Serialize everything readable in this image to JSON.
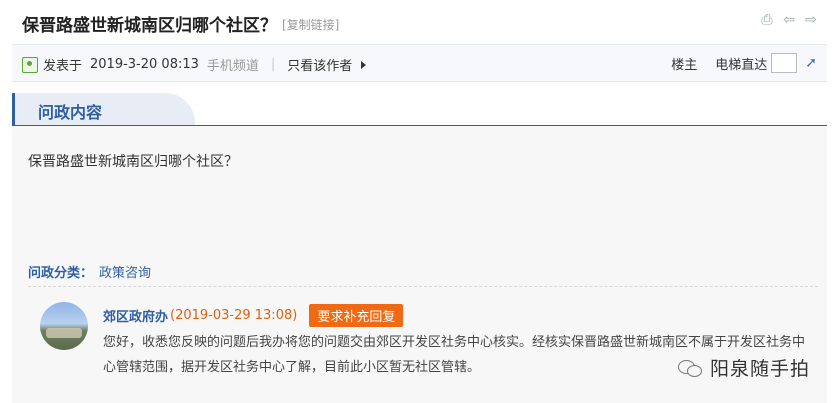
{
  "post": {
    "title": "保晋路盛世新城南区归哪个社区？",
    "copy_link": "[复制链接]"
  },
  "meta": {
    "posted_prefix": "发表于",
    "posted_date": "2019-3-20 08:13",
    "channel": "手机频道",
    "separator": "|",
    "only_author": "只看该作者",
    "floor_host": "楼主",
    "elevator_label": "电梯直达",
    "elevator_value": ""
  },
  "section": {
    "tab_label": "问政内容"
  },
  "content": {
    "question": "保晋路盛世新城南区归哪个社区？",
    "category_label": "问政分类：",
    "category_value": "政策咨询"
  },
  "reply": {
    "author": "郊区政府办",
    "time": "(2019-03-29 13:08)",
    "supplement_button": "要求补充回复",
    "body": "您好，收悉您反映的问题后我办将您的问题交由郊区开发区社务中心核实。经核实保晋路盛世新城南区不属于开发区社务中心管辖范围，据开发区社务中心了解，目前此小区暂无社区管辖。"
  },
  "watermark": {
    "text": "阳泉随手拍"
  },
  "icons": {
    "print": "print-icon",
    "prev": "arrow-left-icon",
    "next": "arrow-right-icon",
    "user": "user-icon",
    "go": "go-icon",
    "wechat": "wechat-icon"
  },
  "colors": {
    "accent": "#2f5fa3",
    "time": "#e06010",
    "button": "#f06a14"
  }
}
